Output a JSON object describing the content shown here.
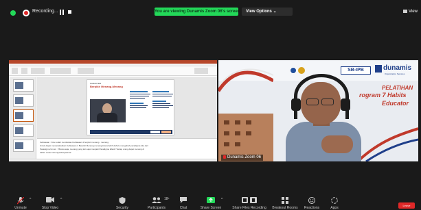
{
  "top_bar": {
    "recording_label": "Recording...",
    "share_banner": "You are viewing Dunamis Zoom 06's screen",
    "view_options": "View Options ⌄",
    "view_label": "View"
  },
  "shared_screen": {
    "slide": {
      "kicker": "KARAKTER",
      "title": "Berpikir Menang-Menang"
    },
    "notes": [
      "Kebiasaan : Kita sudah membahas Kebiasaan 4 berpikir menang - menang.",
      "",
      "Untuk dapat mempraktekkan Kebiasaan 4 Berpikir Menang-menang kita terlebih dahulu mengubah paradigma kita dari",
      "Paradigma Umum : 'Bicara saja, menang yang lain saja' menjadi Paradigma Efektif 'Setiap orang dapat menang di",
      "dalam suatu hubungan/kerjasama'."
    ]
  },
  "speaker_video": {
    "logo_sb": "SB-IPB",
    "logo_dunamis": "dunamis",
    "logo_dunamis_sub": "Organization Services",
    "banner_line1": "PELATIHAN",
    "banner_line2": "rogram 7 Habits",
    "banner_line3": "Educator",
    "name_tag": "Dunamis Zoom 06"
  },
  "toolbar": {
    "items": [
      {
        "label": "Unmute"
      },
      {
        "label": "Stop Video"
      },
      {
        "label": "Security"
      },
      {
        "label": "Participants",
        "count": "18"
      },
      {
        "label": "Chat"
      },
      {
        "label": "Share Screen"
      },
      {
        "label": "Share Files Recording"
      },
      {
        "label": "Breakout Rooms"
      },
      {
        "label": "Reactions"
      },
      {
        "label": "Apps"
      }
    ],
    "leave_label": "Leave"
  },
  "colors": {
    "zoom_green": "#23d959",
    "leave_red": "#e02828",
    "banner_red": "#c0392b",
    "brand_blue": "#1f3f8a"
  }
}
